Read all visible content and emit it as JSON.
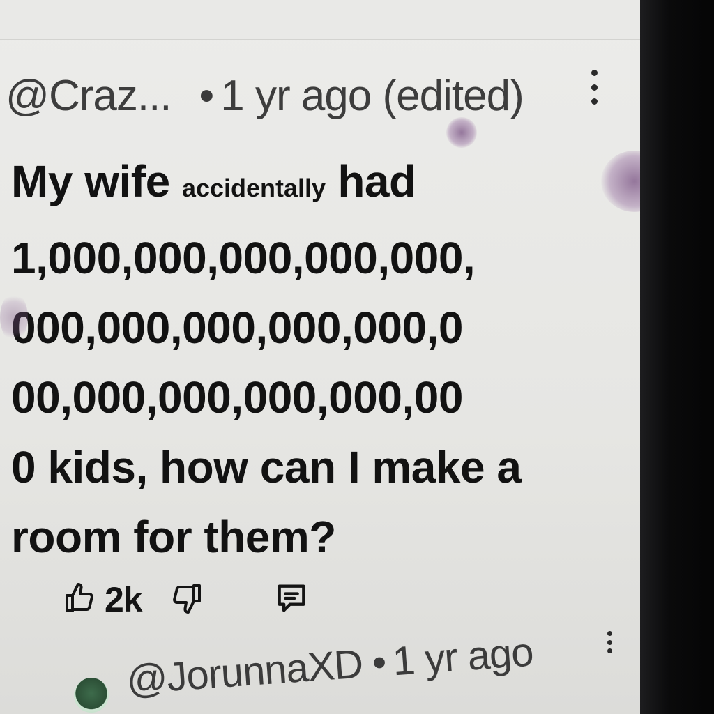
{
  "comment": {
    "author": "@Craz...",
    "separator": "•",
    "time": "1 yr ago (edited)",
    "menu_icon": "more-vertical-icon",
    "body_lines": {
      "l1_a": "My wife",
      "l1_b": "accidentally",
      "l1_c": "had",
      "l2": "1,000,000,000,000,000,",
      "l3": "000,000,000,000,000,0",
      "l4": "00,000,000,000,000,00",
      "l5": "0 kids, how can I make a",
      "l6": "room for them?"
    },
    "actions": {
      "like_icon": "thumbs-up-icon",
      "like_count": "2k",
      "dislike_icon": "thumbs-down-icon",
      "reply_icon": "comment-icon"
    }
  },
  "reply": {
    "author": "@JorunnaXD",
    "separator": "•",
    "time": "1 yr ago",
    "menu_icon": "more-vertical-icon",
    "avatar_icon": "avatar"
  },
  "colors": {
    "screen_bg": "#ececea",
    "text_primary": "#121212",
    "text_secondary": "#3d3d3d"
  }
}
